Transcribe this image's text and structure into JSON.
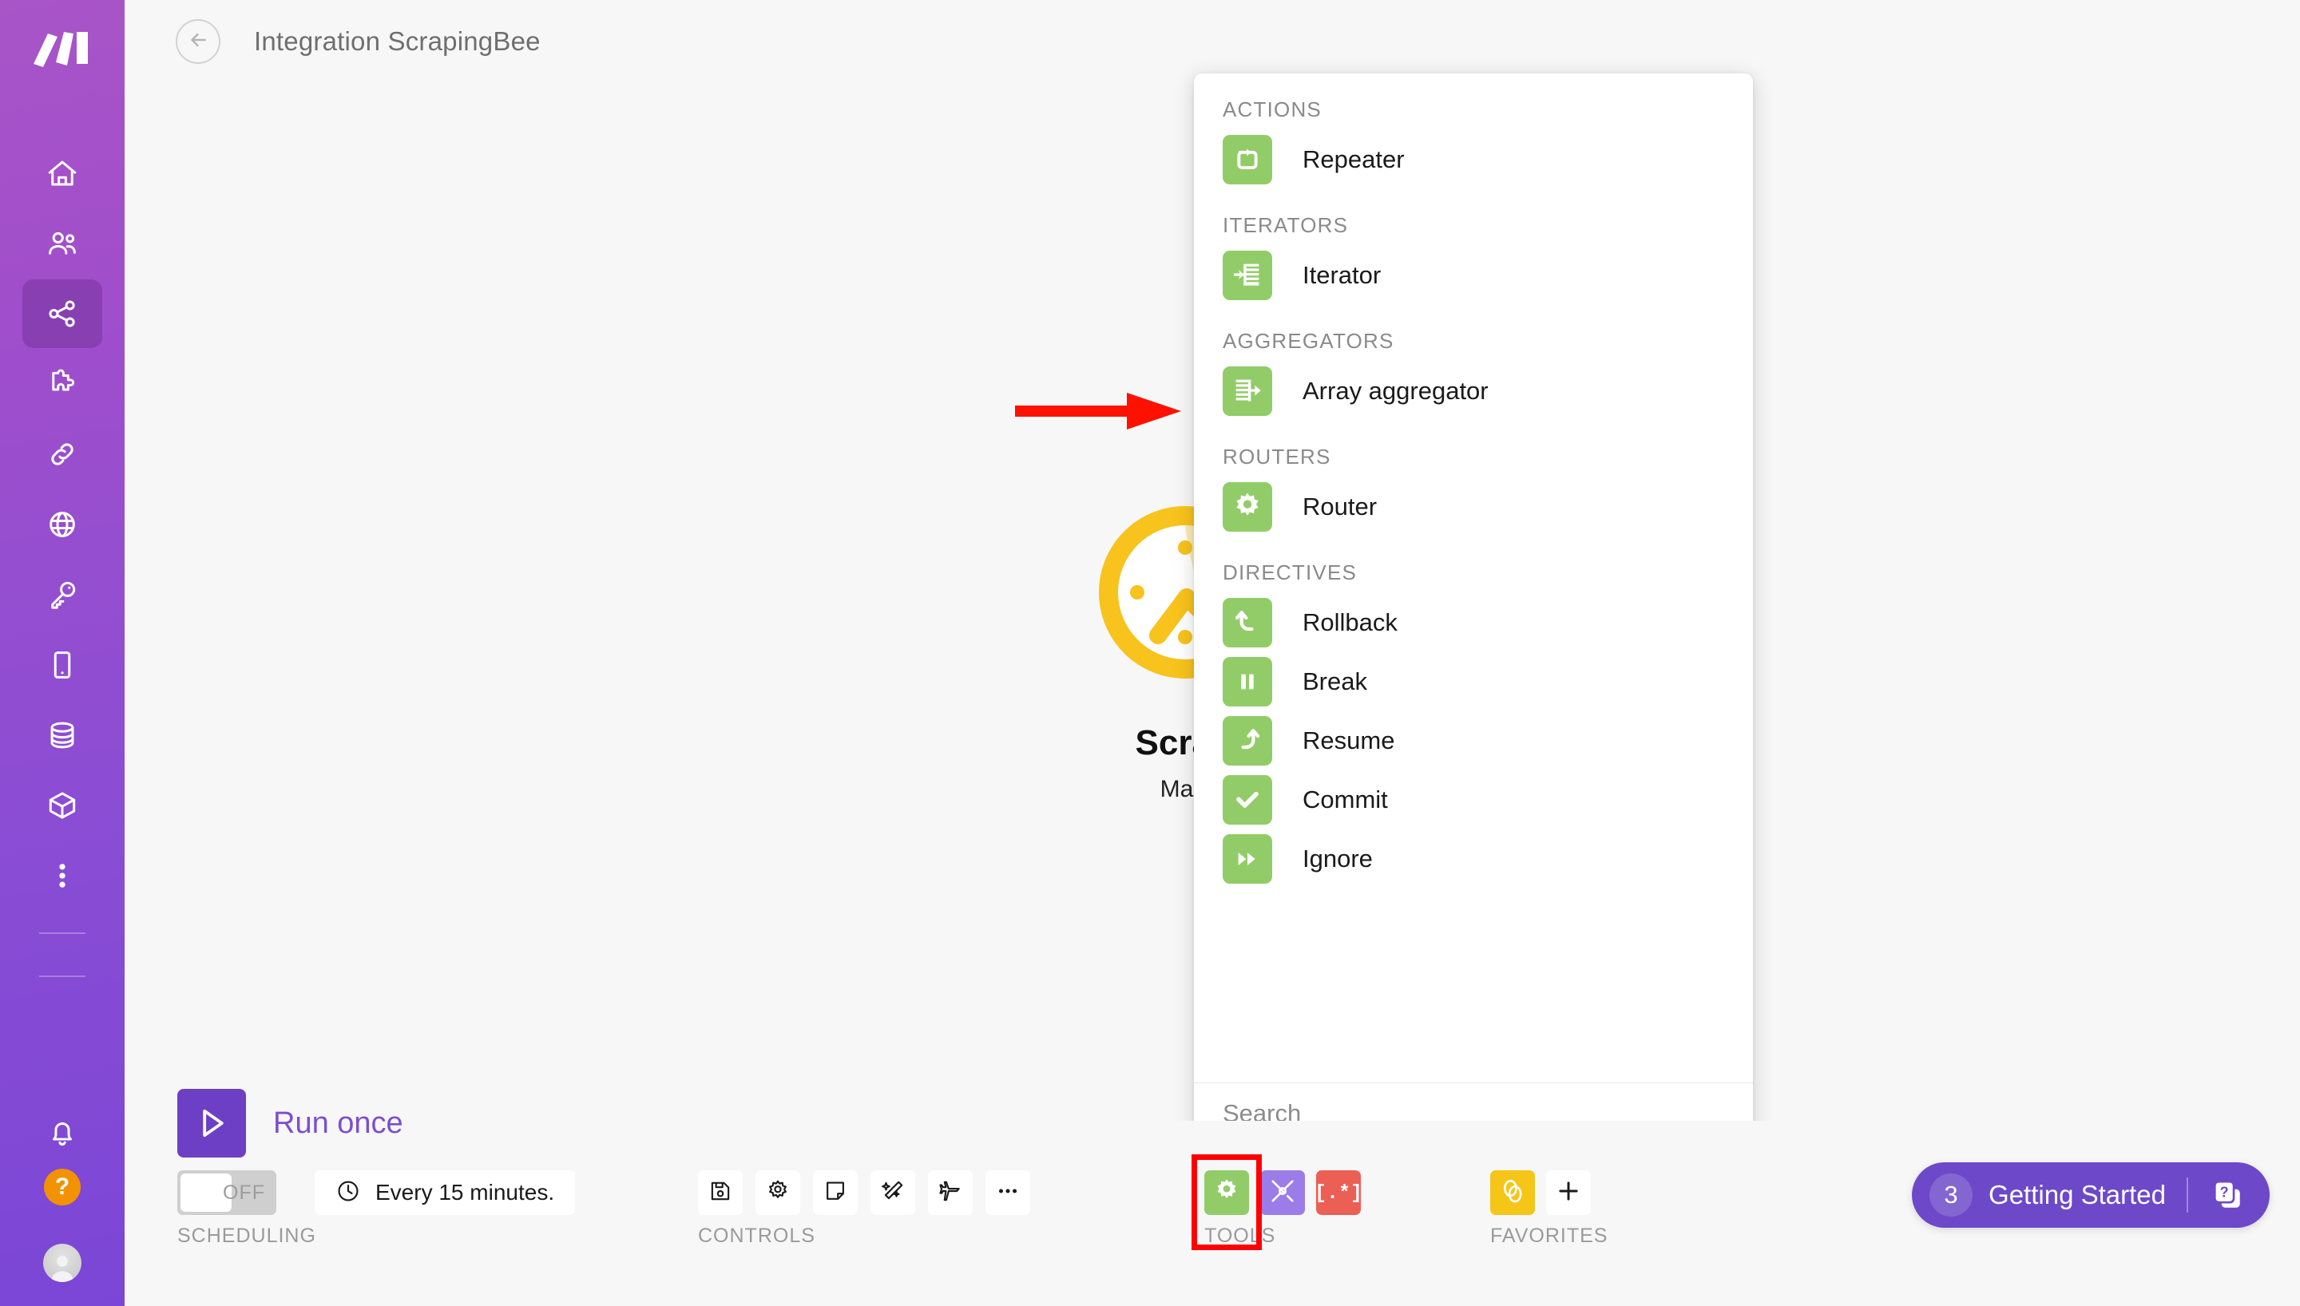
{
  "header": {
    "back_label": "Back",
    "title": "Integration ScrapingBee"
  },
  "sidebar": {
    "logo_name": "make-logo",
    "items": [
      {
        "name": "home",
        "label": "Home",
        "icon": "home-icon",
        "active": false
      },
      {
        "name": "team",
        "label": "Team",
        "icon": "users-icon",
        "active": false
      },
      {
        "name": "scenarios",
        "label": "Scenarios",
        "icon": "share-nodes-icon",
        "active": true
      },
      {
        "name": "templates",
        "label": "Templates",
        "icon": "puzzle-icon",
        "active": false
      },
      {
        "name": "connections",
        "label": "Connections",
        "icon": "link-icon",
        "active": false
      },
      {
        "name": "webhooks",
        "label": "Webhooks",
        "icon": "globe-icon",
        "active": false
      },
      {
        "name": "keys",
        "label": "Keys",
        "icon": "key-icon",
        "active": false
      },
      {
        "name": "devices",
        "label": "Devices",
        "icon": "mobile-icon",
        "active": false
      },
      {
        "name": "data-stores",
        "label": "Data stores",
        "icon": "database-icon",
        "active": false
      },
      {
        "name": "data-structures",
        "label": "Data structures",
        "icon": "cube-icon",
        "active": false
      },
      {
        "name": "more",
        "label": "More",
        "icon": "dots-vertical-icon",
        "active": false
      }
    ],
    "bottom": {
      "notifications_icon": "bell-icon",
      "help_icon": "question-mark-icon",
      "help_badge": "?",
      "avatar_icon": "user-avatar"
    }
  },
  "canvas": {
    "module": {
      "name": "ScrapingBee",
      "tagline": "Make a request",
      "art_icon": "scrapingbee-bee-logo"
    },
    "annotation": {
      "type": "arrow",
      "color": "#FF1100",
      "points_to": "Iterator"
    }
  },
  "tools_panel": {
    "groups": [
      {
        "label": "ACTIONS",
        "items": [
          {
            "label": "Repeater",
            "icon": "repeater-icon"
          }
        ]
      },
      {
        "label": "ITERATORS",
        "items": [
          {
            "label": "Iterator",
            "icon": "iterator-icon"
          }
        ]
      },
      {
        "label": "AGGREGATORS",
        "items": [
          {
            "label": "Array aggregator",
            "icon": "array-aggregator-icon"
          }
        ]
      },
      {
        "label": "ROUTERS",
        "items": [
          {
            "label": "Router",
            "icon": "router-gear-icon"
          }
        ]
      },
      {
        "label": "DIRECTIVES",
        "items": [
          {
            "label": "Rollback",
            "icon": "rollback-icon"
          },
          {
            "label": "Break",
            "icon": "break-pause-icon"
          },
          {
            "label": "Resume",
            "icon": "resume-icon"
          },
          {
            "label": "Commit",
            "icon": "commit-check-icon"
          },
          {
            "label": "Ignore",
            "icon": "ignore-fastforward-icon"
          }
        ]
      }
    ],
    "search": {
      "placeholder": "Search",
      "value": ""
    },
    "icon_color": "#92CC68"
  },
  "bottom_bar": {
    "run_once": {
      "label": "Run once",
      "icon": "play-icon",
      "color": "#6d3fc4"
    },
    "scheduling": {
      "caption": "SCHEDULING",
      "toggle_state": "OFF",
      "interval_label": "Every 15 minutes.",
      "interval_icon": "clock-icon"
    },
    "controls": {
      "caption": "CONTROLS",
      "buttons": [
        {
          "name": "save",
          "icon": "floppy-save-icon"
        },
        {
          "name": "settings",
          "icon": "gear-icon"
        },
        {
          "name": "notes",
          "icon": "note-icon"
        },
        {
          "name": "auto-align",
          "icon": "magic-wand-icon"
        },
        {
          "name": "explore",
          "icon": "airplane-icon"
        },
        {
          "name": "more-options",
          "icon": "ellipsis-icon"
        }
      ]
    },
    "tools": {
      "caption": "TOOLS",
      "highlighted": "tools-gear",
      "highlight_color": "#FF0000",
      "buttons": [
        {
          "name": "tools-gear",
          "icon": "gear-icon",
          "color": "#92CC68"
        },
        {
          "name": "text-tools",
          "icon": "tools-crossed-icon",
          "color": "#9b7ce8"
        },
        {
          "name": "regex",
          "icon": "regex-bracket-icon",
          "label": "[.*]",
          "color": "#eb5f55"
        }
      ]
    },
    "favorites": {
      "caption": "FAVORITES",
      "buttons": [
        {
          "name": "favorite-app",
          "icon": "rings-icon",
          "color": "#F5C518"
        },
        {
          "name": "add-favorite",
          "icon": "plus-icon",
          "color": "#ffffff"
        }
      ]
    },
    "getting_started": {
      "count": "3",
      "label": "Getting Started",
      "icon": "help-cards-icon",
      "color": "#6d49c9"
    }
  }
}
